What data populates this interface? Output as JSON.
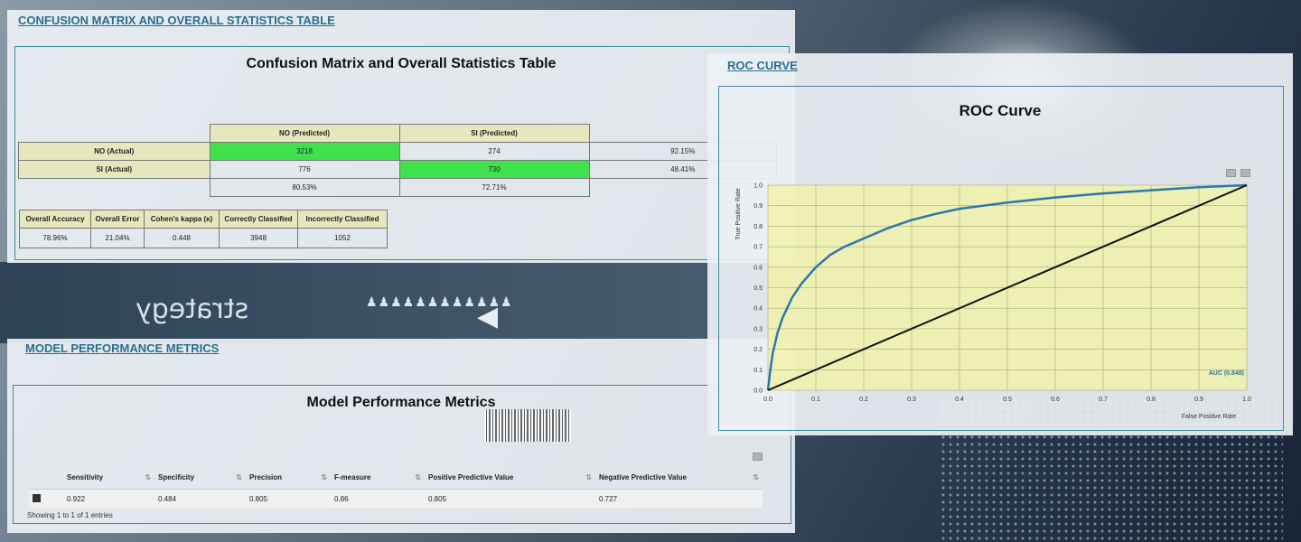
{
  "confusion_section": {
    "section_title": "CONFUSION MATRIX AND OVERALL STATISTICS TABLE",
    "box_title": "Confusion Matrix and Overall Statistics Table",
    "col_headers": [
      "NO (Predicted)",
      "SI (Predicted)"
    ],
    "rows": [
      {
        "label": "NO (Actual)",
        "cells": [
          "3218",
          "274"
        ],
        "rate": "92.15%"
      },
      {
        "label": "SI (Actual)",
        "cells": [
          "776",
          "730"
        ],
        "rate": "48.41%"
      }
    ],
    "col_rates": [
      "80.53%",
      "72.71%"
    ],
    "stats_headers": [
      "Overall Accuracy",
      "Overall Error",
      "Cohen's kappa (κ)",
      "Correctly Classified",
      "Incorrectly Classified"
    ],
    "stats_values": [
      "78.96%",
      "21.04%",
      "0.448",
      "3948",
      "1052"
    ]
  },
  "metrics_section": {
    "section_title": "MODEL PERFORMANCE METRICS",
    "box_title": "Model Performance Metrics",
    "headers": [
      "Sensitivity",
      "Specificity",
      "Precision",
      "F-measure",
      "Positive Predictive Value",
      "Negative Predictive Value"
    ],
    "values": [
      "0.922",
      "0.484",
      "0.805",
      "0.86",
      "0.805",
      "0.727"
    ],
    "footer": "Showing 1 to 1 of 1 entries"
  },
  "roc_section": {
    "section_title": "ROC CURVE",
    "box_title": "ROC Curve"
  },
  "background": {
    "people_glyph": "♟♟♟♟♟♟♟♟♟♟♟♟",
    "arrow_glyph": "◀",
    "word": "strategy"
  },
  "colors": {
    "matrix_diag": "#3fe24a",
    "header_bg": "#e7e7bd",
    "plot_bg": "#f1f1a8",
    "roc_curve": "#2a78b0",
    "diagonal": "#111111",
    "section_title": "#2a6f8f"
  },
  "chart_data": {
    "type": "line",
    "title": "ROC Curve",
    "xlabel": "False Positive Rate",
    "ylabel": "True Positive Rate",
    "xlim": [
      0,
      1
    ],
    "ylim": [
      0,
      1
    ],
    "xticks": [
      "0.0",
      "0.1",
      "0.2",
      "0.3",
      "0.4",
      "0.5",
      "0.6",
      "0.7",
      "0.8",
      "0.9",
      "1.0"
    ],
    "yticks": [
      "0.0",
      "0.1",
      "0.2",
      "0.3",
      "0.4",
      "0.5",
      "0.6",
      "0.7",
      "0.8",
      "0.9",
      "1.0"
    ],
    "grid": true,
    "annotation": "AUC (0.848)",
    "series": [
      {
        "x": [
          0,
          0.005,
          0.01,
          0.02,
          0.03,
          0.05,
          0.07,
          0.1,
          0.13,
          0.16,
          0.2,
          0.25,
          0.3,
          0.35,
          0.4,
          0.5,
          0.6,
          0.7,
          0.8,
          0.9,
          1.0
        ],
        "y": [
          0,
          0.1,
          0.18,
          0.28,
          0.35,
          0.45,
          0.52,
          0.6,
          0.66,
          0.7,
          0.74,
          0.79,
          0.83,
          0.86,
          0.885,
          0.915,
          0.94,
          0.96,
          0.975,
          0.99,
          1.0
        ]
      },
      {
        "x": [
          0,
          1
        ],
        "y": [
          0,
          1
        ]
      }
    ]
  }
}
